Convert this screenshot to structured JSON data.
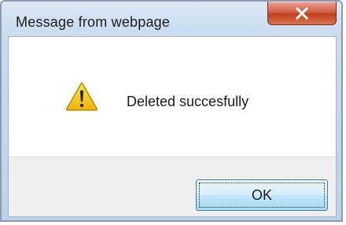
{
  "window": {
    "title": "Message from webpage",
    "close_icon": "close-x-icon"
  },
  "dialog": {
    "icon": "warning-icon",
    "message": "Deleted succesfully",
    "ok_label": "OK"
  },
  "colors": {
    "close_button": "#c94a2f",
    "ok_border": "#3c7fb1",
    "warning_yellow": "#f5c400"
  }
}
